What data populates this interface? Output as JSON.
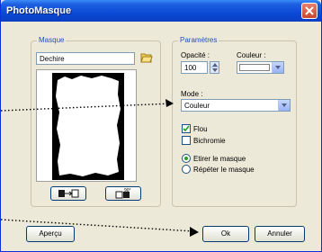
{
  "window": {
    "title": "PhotoMasque"
  },
  "masque": {
    "legend": "Masque",
    "value": "Dechire"
  },
  "parametres": {
    "legend": "Paramètres",
    "opacite_label": "Opacité :",
    "opacite_value": "100",
    "couleur_label": "Couleur :",
    "mode_label": "Mode :",
    "mode_value": "Couleur",
    "flou_label": "Flou",
    "flou_checked": true,
    "bichromie_label": "Bichromie",
    "bichromie_checked": false,
    "etirer_label": "Etirer le masque",
    "repeter_label": "Répéter le masque",
    "selected_option": "Etirer le masque"
  },
  "buttons": {
    "apercu": "Aperçu",
    "ok": "Ok",
    "annuler": "Annuler"
  },
  "icons": {
    "folder": "folder-open-icon",
    "flip": "flip-horizontal-icon",
    "rotate": "rotate-90-icon",
    "close": "close-icon"
  },
  "colors": {
    "titlebar": "#0a4ad6",
    "legend": "#1f4fbf",
    "close": "#c8482e"
  }
}
